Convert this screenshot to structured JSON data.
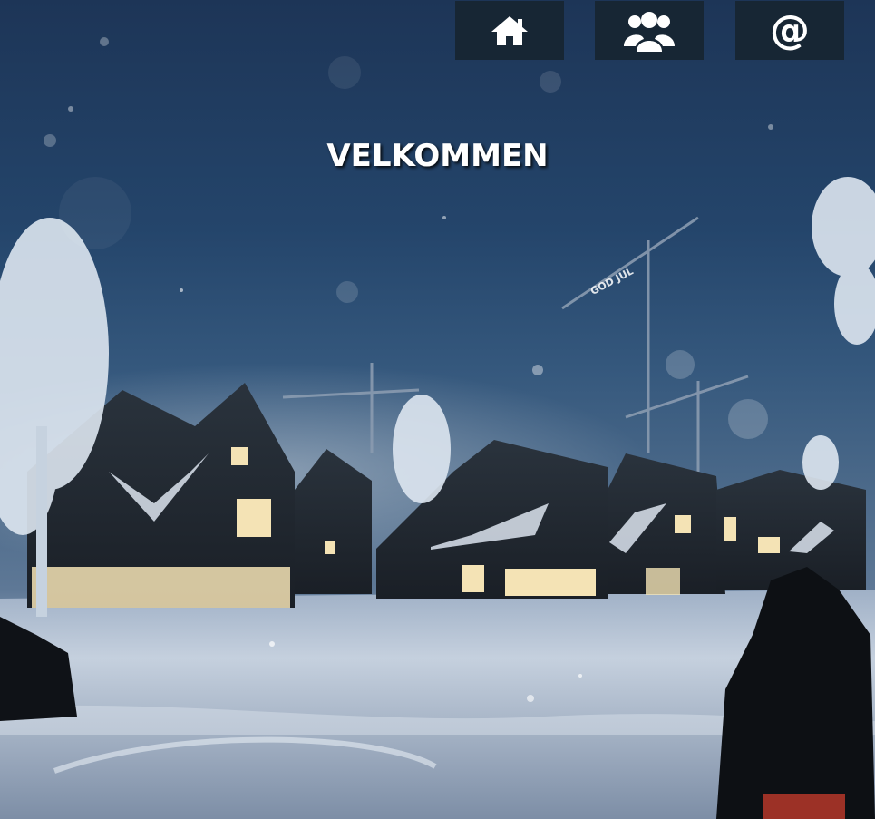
{
  "nav": {
    "items": [
      {
        "icon": "home-icon"
      },
      {
        "icon": "users-icon"
      },
      {
        "icon": "at-icon",
        "glyph": "@"
      }
    ],
    "background": "#172634",
    "icon_color": "#ffffff"
  },
  "hero": {
    "title": "VELKOMMEN",
    "sign_text": "GOD JUL"
  }
}
